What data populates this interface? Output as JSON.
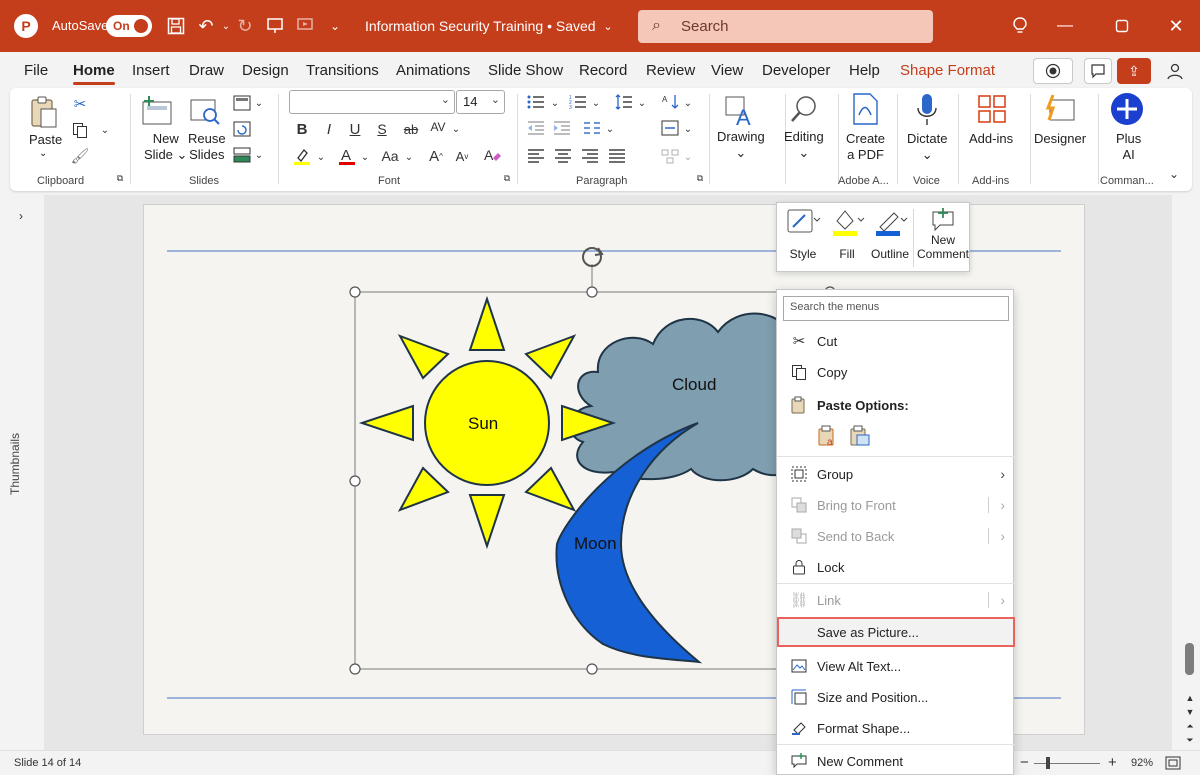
{
  "titlebar": {
    "app_logo": "P",
    "autosave_label": "AutoSave",
    "autosave_state": "On",
    "doc_title": "Information Security Training • Saved",
    "search_placeholder": "Search",
    "icons": [
      "save-icon",
      "undo-icon",
      "redo-icon",
      "present-icon",
      "customize-icon",
      "lightbulb-icon",
      "minimize-icon",
      "maximize-icon",
      "close-icon"
    ]
  },
  "tabs": [
    {
      "label": "File"
    },
    {
      "label": "Home"
    },
    {
      "label": "Insert"
    },
    {
      "label": "Draw"
    },
    {
      "label": "Design"
    },
    {
      "label": "Transitions"
    },
    {
      "label": "Animations"
    },
    {
      "label": "Slide Show"
    },
    {
      "label": "Record"
    },
    {
      "label": "Review"
    },
    {
      "label": "View"
    },
    {
      "label": "Developer"
    },
    {
      "label": "Help"
    },
    {
      "label": "Shape Format"
    }
  ],
  "ribbon": {
    "clipboard": {
      "paste": "Paste",
      "group": "Clipboard"
    },
    "slides": {
      "new_slide": "New",
      "new_slide2": "Slide",
      "reuse": "Reuse",
      "reuse2": "Slides",
      "group": "Slides"
    },
    "font": {
      "family": "",
      "size": "14",
      "group": "Font",
      "bold": "B",
      "italic": "I",
      "underline": "U",
      "shadow": "S",
      "strike": "ab",
      "spacing": "AV",
      "case": "Aa",
      "grow": "A",
      "shrink": "A"
    },
    "paragraph": {
      "group": "Paragraph"
    },
    "drawing": {
      "label": "Drawing"
    },
    "editing": {
      "label": "Editing"
    },
    "adobe": {
      "label": "Create",
      "label2": "a PDF",
      "group": "Adobe A..."
    },
    "voice": {
      "label": "Dictate",
      "group": "Voice"
    },
    "addins": {
      "label": "Add-ins",
      "group": "Add-ins"
    },
    "designer": {
      "label": "Designer"
    },
    "plusai": {
      "label": "Plus",
      "label2": "AI",
      "group": "Comman..."
    }
  },
  "left_rail": {
    "label": "Thumbnails"
  },
  "slide": {
    "sun": "Sun",
    "cloud": "Cloud",
    "moon": "Moon"
  },
  "colors": {
    "accent": "#c43e1c",
    "sun": "#ffff00",
    "cloud": "#7f9eaf",
    "moon": "#1560d4",
    "highlight": "#e8625e"
  },
  "minibar": {
    "style": "Style",
    "fill": "Fill",
    "outline": "Outline",
    "new": "New",
    "comment": "Comment"
  },
  "context_menu": {
    "search_placeholder": "Search the menus",
    "cut": "Cut",
    "copy": "Copy",
    "paste_options": "Paste Options:",
    "group": "Group",
    "bring_to_front": "Bring to Front",
    "send_to_back": "Send to Back",
    "lock": "Lock",
    "link": "Link",
    "save_as_picture": "Save as Picture...",
    "view_alt_text": "View Alt Text...",
    "size_and_position": "Size and Position...",
    "format_shape": "Format Shape...",
    "new_comment": "New Comment"
  },
  "statusbar": {
    "slide_info": "Slide 14 of 14",
    "zoom": "92%",
    "minus": "−",
    "plus": "+"
  }
}
